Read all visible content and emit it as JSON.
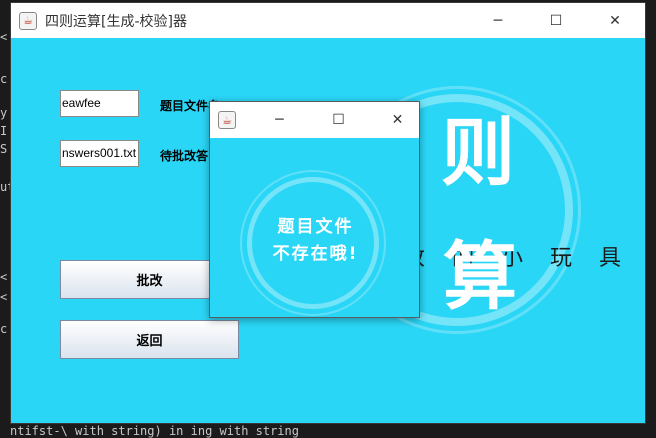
{
  "main_window": {
    "title": "四则运算[生成-校验]器",
    "controls": {
      "minimize": "─",
      "maximize": "☐",
      "close": "✕"
    },
    "form": {
      "question_file_value": "eawfee",
      "question_file_label": "题目文件名",
      "answer_file_value": "nswers001.txt",
      "answer_file_label": "待批改答"
    },
    "buttons": {
      "grade_label": "批改",
      "back_label": "返回"
    },
    "logo": {
      "char_top": "则",
      "tagline": "改 的 小 玩 具",
      "char_bottom": "算"
    }
  },
  "dialog": {
    "controls": {
      "minimize": "─",
      "maximize": "☐",
      "close": "✕"
    },
    "message_line1": "题目文件",
    "message_line2": "不存在哦!"
  },
  "terminal": {
    "bottom_line": "ntifst-\\ with string) in ing with string",
    "left_chars": [
      "<",
      "c",
      "y",
      "I",
      "S",
      "ut",
      "<",
      "<",
      "c"
    ]
  },
  "colors": {
    "accent": "#2ad6f6",
    "titlebar": "#ffffff"
  }
}
